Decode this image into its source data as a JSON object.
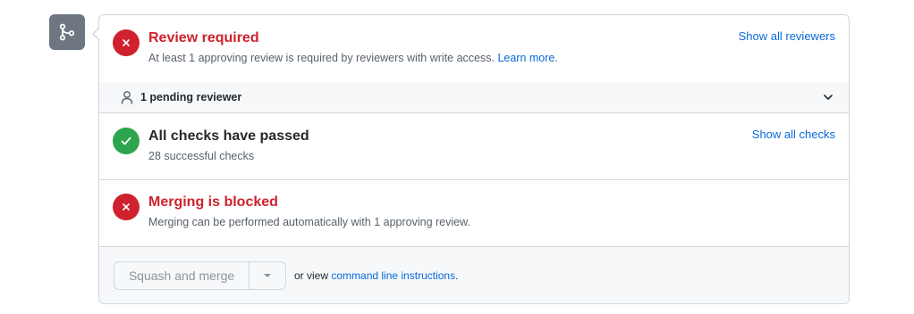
{
  "review": {
    "title": "Review required",
    "description": "At least 1 approving review is required by reviewers with write access.",
    "learn_more": "Learn more",
    "description_end": ".",
    "show_all": "Show all reviewers",
    "pending": "1 pending reviewer"
  },
  "checks": {
    "title": "All checks have passed",
    "description": "28 successful checks",
    "show_all": "Show all checks"
  },
  "merging": {
    "title": "Merging is blocked",
    "description": "Merging can be performed automatically with 1 approving review."
  },
  "footer": {
    "merge_button": "Squash and merge",
    "or_view": "or view",
    "cli_link": "command line instructions",
    "period": "."
  },
  "icons": {
    "merge": "git-merge-icon",
    "review_status": "x-circle-icon",
    "checks_status": "check-circle-icon",
    "merging_status": "x-circle-icon",
    "pending": "person-icon",
    "expand": "chevron-down-icon",
    "merge_options": "triangle-down-icon"
  },
  "colors": {
    "danger": "#cf222e",
    "success": "#2da44e",
    "link": "#0969da",
    "merge_icon_bg": "#6e7781"
  }
}
